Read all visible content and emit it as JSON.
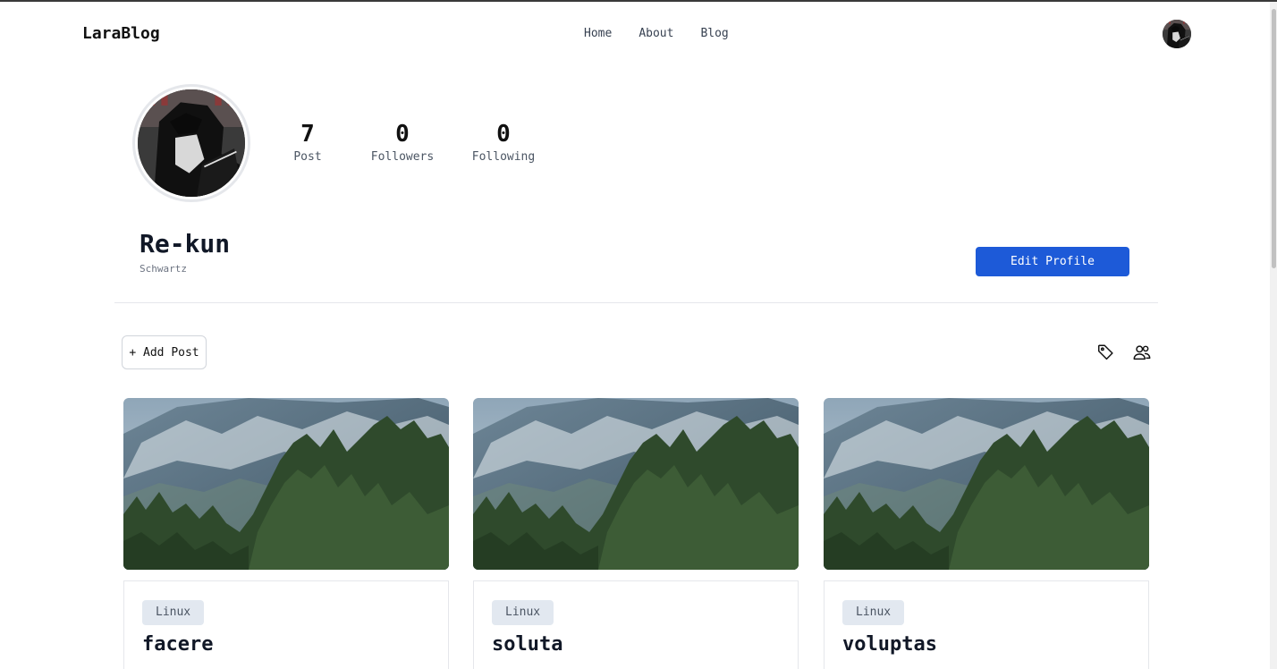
{
  "brand": "LaraBlog",
  "nav": {
    "links": [
      "Home",
      "About",
      "Blog"
    ]
  },
  "profile": {
    "name": "Re-kun",
    "handle": "Schwartz",
    "stats": [
      {
        "value": "7",
        "label": "Post"
      },
      {
        "value": "0",
        "label": "Followers"
      },
      {
        "value": "0",
        "label": "Following"
      }
    ],
    "edit_label": "Edit Profile"
  },
  "toolbar": {
    "add_post_label": "+ Add Post",
    "icons": [
      "tag-icon",
      "users-icon"
    ]
  },
  "posts": [
    {
      "tag": "Linux",
      "title": "facere"
    },
    {
      "tag": "Linux",
      "title": "soluta"
    },
    {
      "tag": "Linux",
      "title": "voluptas"
    }
  ],
  "colors": {
    "accent": "#1d5ad8",
    "tag_bg": "#e2e8f0"
  }
}
